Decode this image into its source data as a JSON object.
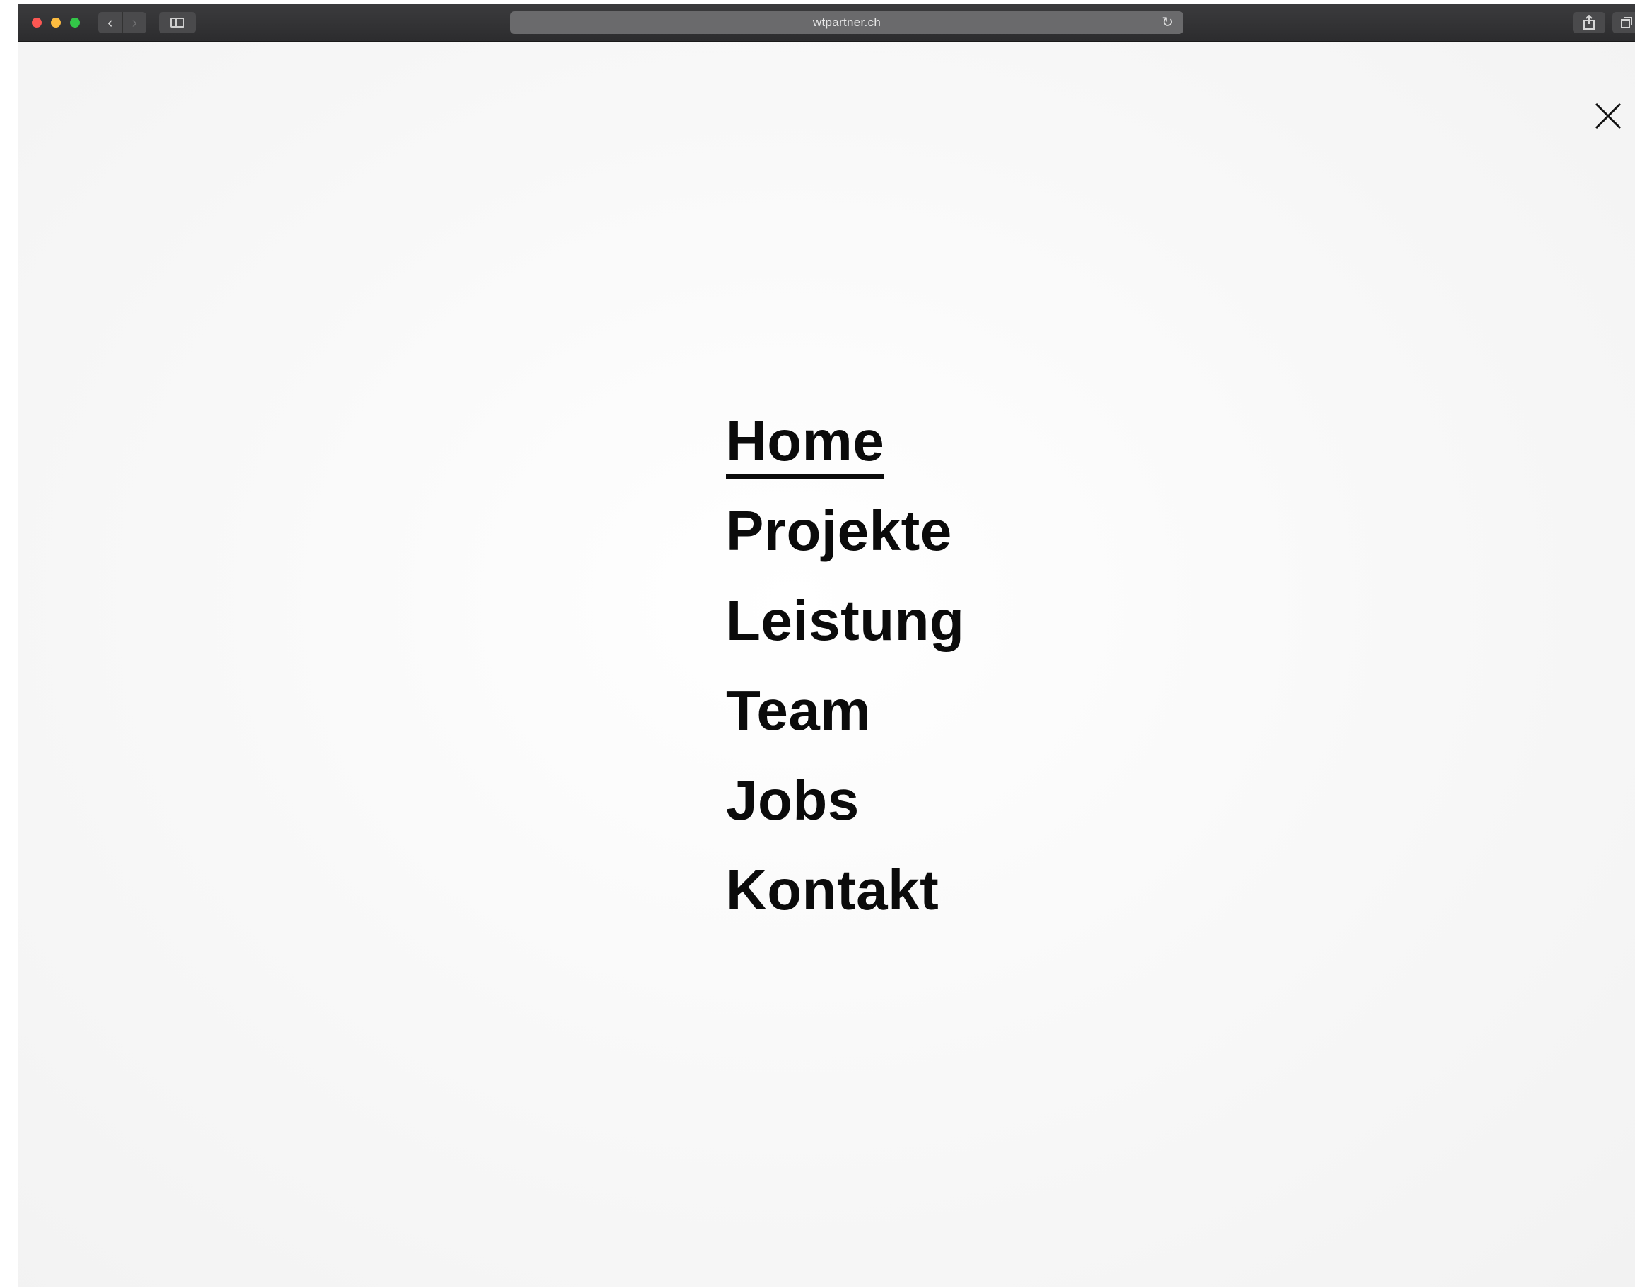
{
  "browser": {
    "url": "wtpartner.ch",
    "back_icon": "‹",
    "forward_icon": "›",
    "reload_icon": "↻"
  },
  "menu": {
    "items": [
      {
        "label": "Home",
        "active": true
      },
      {
        "label": "Projekte",
        "active": false
      },
      {
        "label": "Leistung",
        "active": false
      },
      {
        "label": "Team",
        "active": false
      },
      {
        "label": "Jobs",
        "active": false
      },
      {
        "label": "Kontakt",
        "active": false
      }
    ]
  },
  "icons": {
    "close": "close-icon",
    "share": "share-icon",
    "tabs": "tabs-icon",
    "sidebar": "sidebar-icon"
  },
  "colors": {
    "text": "#0b0b0b",
    "page_background": "#f4f4f4",
    "toolbar": "#2c2c2e"
  }
}
